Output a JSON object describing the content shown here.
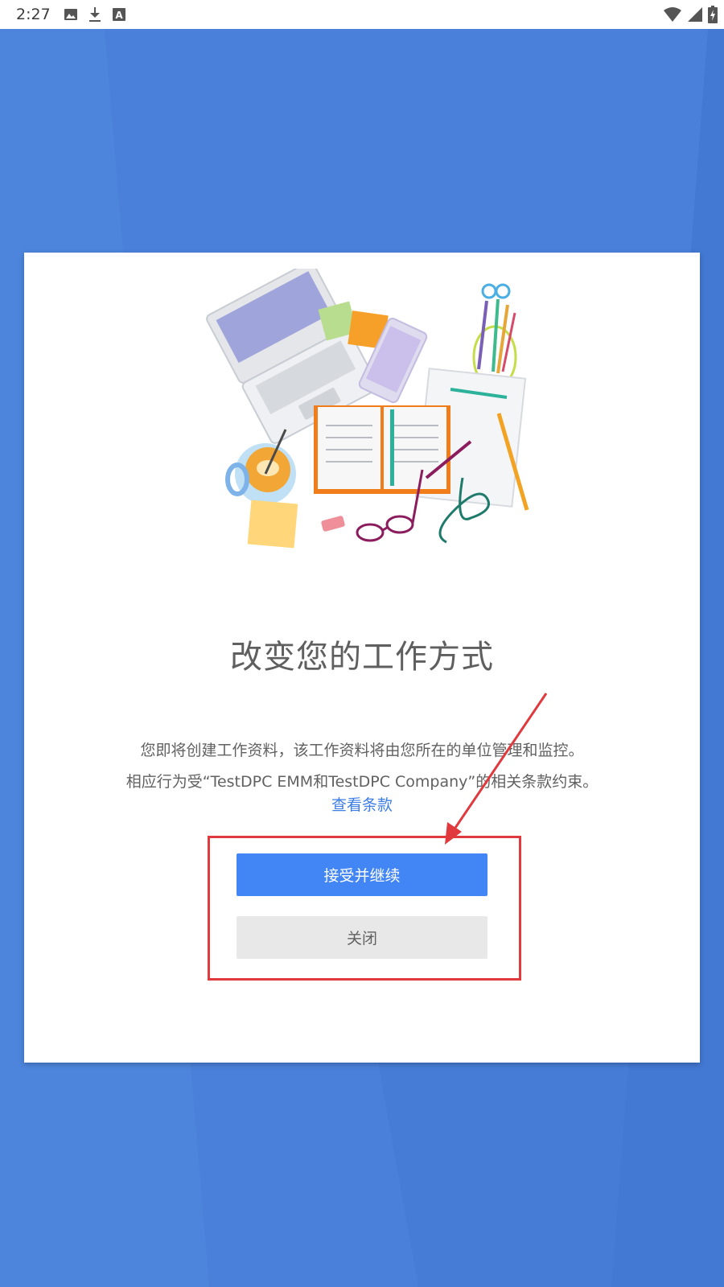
{
  "status_bar": {
    "time": "2:27",
    "left_icons": [
      "image-icon",
      "download-icon",
      "text-a-icon"
    ],
    "right_icons": [
      "wifi-icon",
      "signal-icon",
      "battery-icon"
    ]
  },
  "colors": {
    "background": "#4a80d9",
    "accept_button": "#4285f4",
    "close_button": "#e8e8e8",
    "link": "#3d7ee6",
    "annotation": "#e0393e"
  },
  "dialog": {
    "title": "改变您的工作方式",
    "description_line1": "您即将创建工作资料，该工作资料将由您所在的单位管理和监控。",
    "description_line2": "相应行为受“TestDPC EMM和TestDPC Company”的相关条款约束。",
    "terms_link": "查看条款",
    "accept_button": "接受并继续",
    "close_button": "关闭"
  }
}
